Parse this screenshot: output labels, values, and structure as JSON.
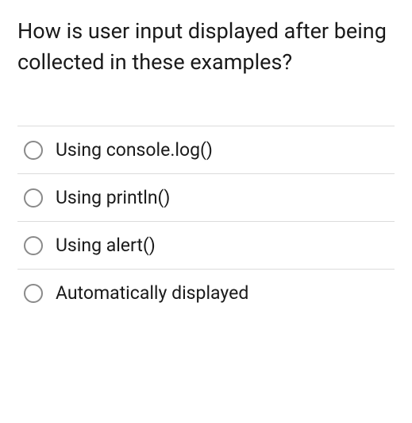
{
  "question": "How is user input displayed after being collected in these examples?",
  "options": [
    {
      "label": "Using console.log()"
    },
    {
      "label": "Using println()"
    },
    {
      "label": "Using alert()"
    },
    {
      "label": "Automatically displayed"
    }
  ]
}
